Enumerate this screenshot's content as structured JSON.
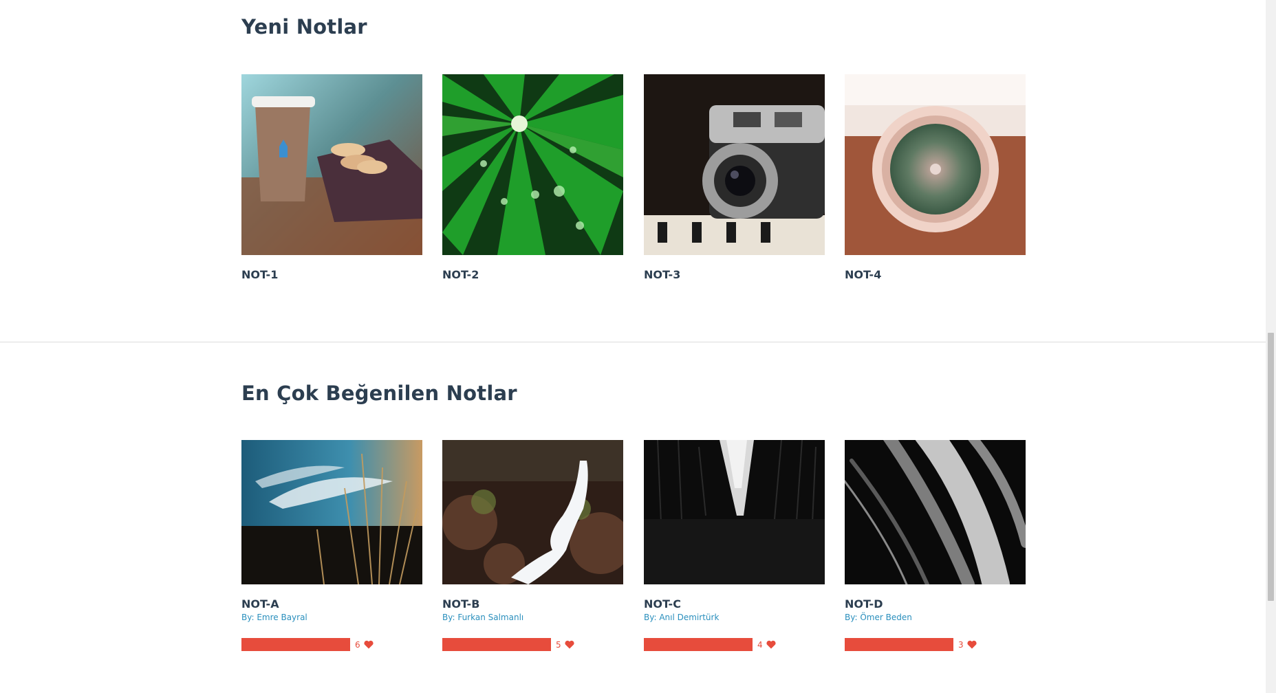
{
  "new_notes": {
    "title": "Yeni Notlar",
    "items": [
      {
        "title": "NOT-1",
        "image": "coffee-macarons-image"
      },
      {
        "title": "NOT-2",
        "image": "green-leaf-droplets-image"
      },
      {
        "title": "NOT-3",
        "image": "vintage-camera-image"
      },
      {
        "title": "NOT-4",
        "image": "cactus-pot-image"
      }
    ]
  },
  "liked_notes": {
    "title": "En Çok Beğenilen Notlar",
    "items": [
      {
        "title": "NOT-A",
        "author": "By: Emre Bayral",
        "likes": "6",
        "image": "sky-grass-image"
      },
      {
        "title": "NOT-B",
        "author": "By: Furkan Salmanlı",
        "likes": "5",
        "image": "waterfall-image"
      },
      {
        "title": "NOT-C",
        "author": "By: Anıl Demirtürk",
        "likes": "4",
        "image": "dark-trees-image"
      },
      {
        "title": "NOT-D",
        "author": "By: Ömer Beden",
        "likes": "3",
        "image": "abstract-light-image"
      }
    ]
  },
  "colors": {
    "heading": "#2c3e50",
    "author_link": "#2a8fbd",
    "like_bar": "#e74c3c"
  }
}
